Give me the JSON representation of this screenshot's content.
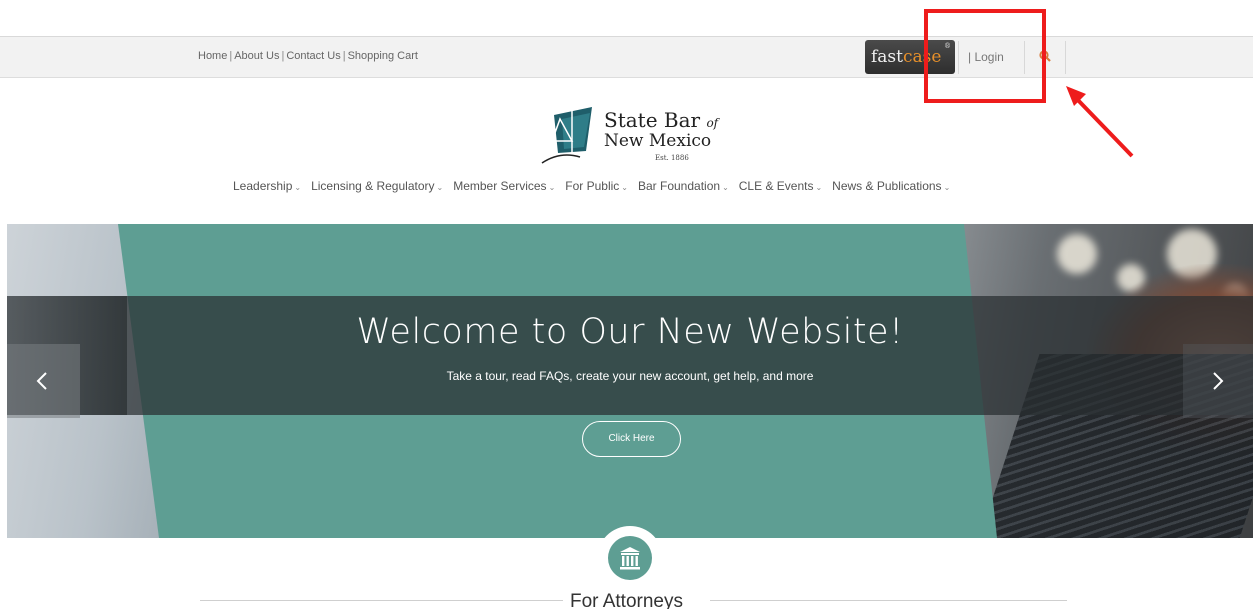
{
  "topbar": {
    "links": [
      {
        "label": "Home"
      },
      {
        "label": "About Us"
      },
      {
        "label": "Contact Us"
      },
      {
        "label": "Shopping Cart"
      }
    ],
    "separator": "|",
    "fastcase": {
      "part1": "fast",
      "part2": "case",
      "tm": "®"
    },
    "login_label": "| Login",
    "search_icon": "search-icon"
  },
  "logo": {
    "line1": "State Bar",
    "line1_suffix": "of",
    "line2": "New Mexico",
    "est": "Est. 1886"
  },
  "nav": {
    "items": [
      {
        "label": "Leadership"
      },
      {
        "label": "Licensing & Regulatory"
      },
      {
        "label": "Member Services"
      },
      {
        "label": "For Public"
      },
      {
        "label": "Bar Foundation"
      },
      {
        "label": "CLE & Events"
      },
      {
        "label": "News & Publications"
      }
    ],
    "chevron": "⌄"
  },
  "hero": {
    "title": "Welcome to Our New Website!",
    "subtitle": "Take a tour, read FAQs, create your new account, get help, and more",
    "button_label": "Click Here",
    "prev_icon": "chevron-left-icon",
    "next_icon": "chevron-right-icon",
    "accent_color": "#5e9e93"
  },
  "section": {
    "title": "For Attorneys",
    "icon": "courthouse-icon"
  },
  "annotation": {
    "color": "#ee1c1c"
  }
}
